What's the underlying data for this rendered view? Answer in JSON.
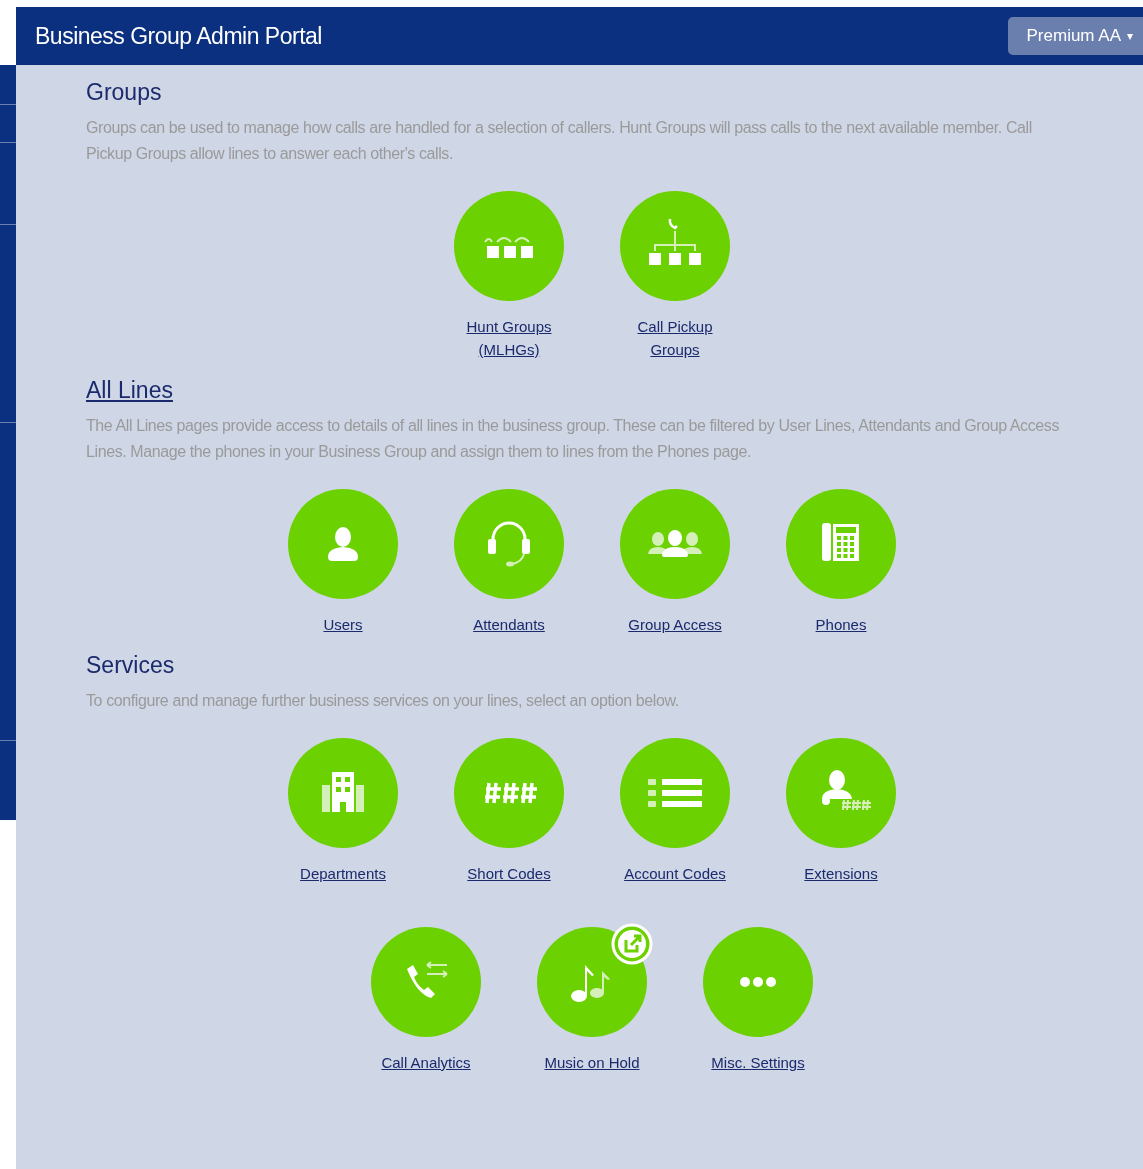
{
  "header": {
    "title": "Business Group Admin Portal",
    "account_menu": {
      "label": "Premium AA",
      "caret": "▾"
    }
  },
  "sections": [
    {
      "title": "Groups",
      "link": false,
      "description": "Groups can be used to manage how calls are handled for a selection of callers. Hunt Groups will pass calls to the next available member. Call Pickup Groups allow lines to answer each other's calls.",
      "rows": [
        [
          {
            "label": "Hunt Groups (MLHGs)",
            "kind": "hunt"
          },
          {
            "label": "Call Pickup Groups",
            "kind": "pickup"
          }
        ]
      ]
    },
    {
      "title": "All Lines",
      "link": true,
      "description": "The All Lines pages provide access to details of all lines in the business group. These can be filtered by User Lines, Attendants and Group Access Lines. Manage the phones in your Business Group and assign them to lines from the Phones page.",
      "rows": [
        [
          {
            "label": "Users",
            "kind": "user"
          },
          {
            "label": "Attendants",
            "kind": "headset"
          },
          {
            "label": "Group Access",
            "kind": "group"
          },
          {
            "label": "Phones",
            "kind": "phone"
          }
        ]
      ]
    },
    {
      "title": "Services",
      "link": false,
      "description": "To configure and manage further business services on your lines, select an option below.",
      "rows": [
        [
          {
            "label": "Departments",
            "kind": "building"
          },
          {
            "label": "Short Codes",
            "kind": "hash"
          },
          {
            "label": "Account Codes",
            "kind": "list"
          },
          {
            "label": "Extensions",
            "kind": "extension"
          }
        ],
        [
          {
            "label": "Call Analytics",
            "kind": "analytics"
          },
          {
            "label": "Music on Hold",
            "kind": "music",
            "external": true
          },
          {
            "label": "Misc. Settings",
            "kind": "more"
          }
        ]
      ]
    }
  ]
}
